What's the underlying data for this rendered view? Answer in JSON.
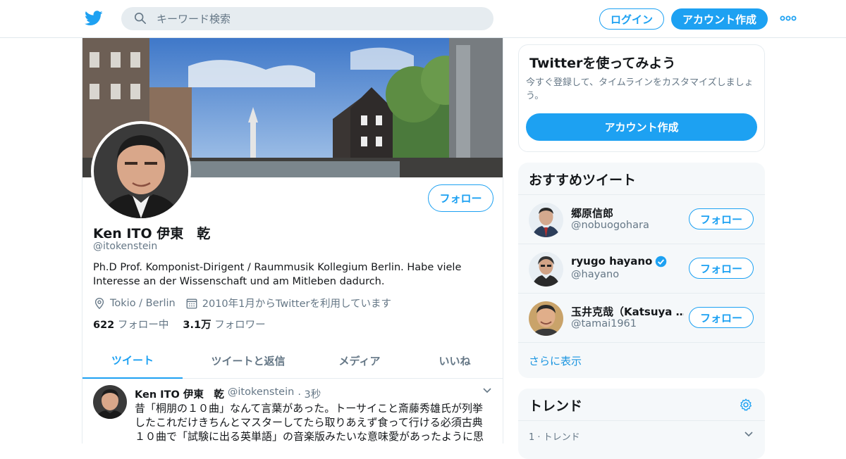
{
  "topbar": {
    "logo": "twitter-bird-icon",
    "search_placeholder": "キーワード検索",
    "login_label": "ログイン",
    "signup_label": "アカウント作成",
    "more": "more-icon"
  },
  "profile": {
    "follow_label": "フォロー",
    "name": "Ken ITO 伊東　乾",
    "handle": "@itokenstein",
    "bio": "Ph.D Prof. Komponist-Dirigent / Raummusik Kollegium Berlin. Habe viele Interesse an der Wissenschaft und am Mitleben dadurch.",
    "location": "Tokio / Berlin",
    "joined": "2010年1月からTwitterを利用しています",
    "following_count": "622",
    "following_label": "フォロー中",
    "followers_count": "3.1万",
    "followers_label": "フォロワー"
  },
  "tabs": [
    {
      "label": "ツイート",
      "active": true
    },
    {
      "label": "ツイートと返信",
      "active": false
    },
    {
      "label": "メディア",
      "active": false
    },
    {
      "label": "いいね",
      "active": false
    }
  ],
  "tweet": {
    "name": "Ken ITO 伊東　乾",
    "handle": "@itokenstein",
    "time": "· 3秒",
    "text": "昔「桐朋の１０曲」なんて言葉があった。トーサイこと斎藤秀雄氏が列挙したこれだけきちんとマスターしてたら取りあえず食って行ける必須古典１０曲で「試験に出る英単語」の音楽版みたいな意味愛があったように思"
  },
  "signup_card": {
    "title": "Twitterを使ってみよう",
    "description": "今すぐ登録して、タイムラインをカスタマイズしましょう。",
    "button_label": "アカウント作成"
  },
  "recommend": {
    "title": "おすすめツイート",
    "items": [
      {
        "name": "郷原信郎",
        "handle": "@nobuogohara",
        "verified": false,
        "follow_label": "フォロー"
      },
      {
        "name": "ryugo hayano",
        "handle": "@hayano",
        "verified": true,
        "follow_label": "フォロー"
      },
      {
        "name": "玉井克哉（Katsuya …",
        "handle": "@tamai1961",
        "verified": false,
        "follow_label": "フォロー"
      }
    ],
    "show_more": "さらに表示"
  },
  "trends": {
    "title": "トレンド",
    "first_item": "1 · トレンド"
  },
  "colors": {
    "accent": "#1da1f2",
    "link": "#1b95e0",
    "secondary_text": "#657786",
    "panel_bg": "#f5f8fa"
  }
}
